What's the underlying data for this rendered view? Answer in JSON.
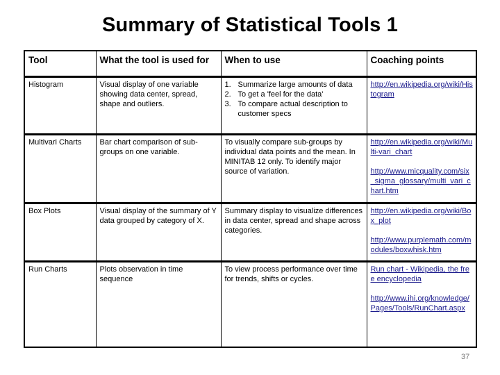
{
  "title": "Summary of Statistical Tools 1",
  "table": {
    "headers": [
      "Tool",
      "What the tool is used for",
      "When to use",
      "Coaching points"
    ],
    "rows": [
      {
        "tool": "Histogram",
        "purpose": "Visual display of one variable showing data center, spread, shape and outliers.",
        "when_list": [
          {
            "num": "1.",
            "text": "Summarize large amounts of data"
          },
          {
            "num": "2.",
            "text": "To get a 'feel for the data'"
          },
          {
            "num": "3.",
            "text": "To compare actual description to customer specs"
          }
        ],
        "links": [
          "http://en.wikipedia.org/wiki/Histogram"
        ]
      },
      {
        "tool": "Multivari Charts",
        "purpose": "Bar chart comparison of sub-groups on one variable.",
        "when": "To visually compare sub-groups by individual data points and the mean. In MINITAB 12 only.  To identify major source of variation.",
        "links": [
          "http://en.wikipedia.org/wiki/Multi-vari_chart",
          "http://www.micquality.com/six_sigma_glossary/multi_vari_chart.htm"
        ]
      },
      {
        "tool": "Box Plots",
        "purpose": "Visual display of the summary of Y data grouped by category of X.",
        "when": "Summary display to visualize differences in data center, spread and shape across categories.",
        "links": [
          "http://en.wikipedia.org/wiki/Box_plot",
          "http://www.purplemath.com/modules/boxwhisk.htm"
        ]
      },
      {
        "tool": "Run Charts",
        "purpose": "Plots observation in time sequence",
        "when": "To view process performance over time for trends, shifts or cycles.",
        "links": [
          "Run chart - Wikipedia, the free encyclopedia",
          "http://www.ihi.org/knowledge/Pages/Tools/RunChart.aspx"
        ]
      }
    ]
  },
  "page_number": "37",
  "colors": {
    "link": "#1a1a8c",
    "border": "#000000"
  }
}
